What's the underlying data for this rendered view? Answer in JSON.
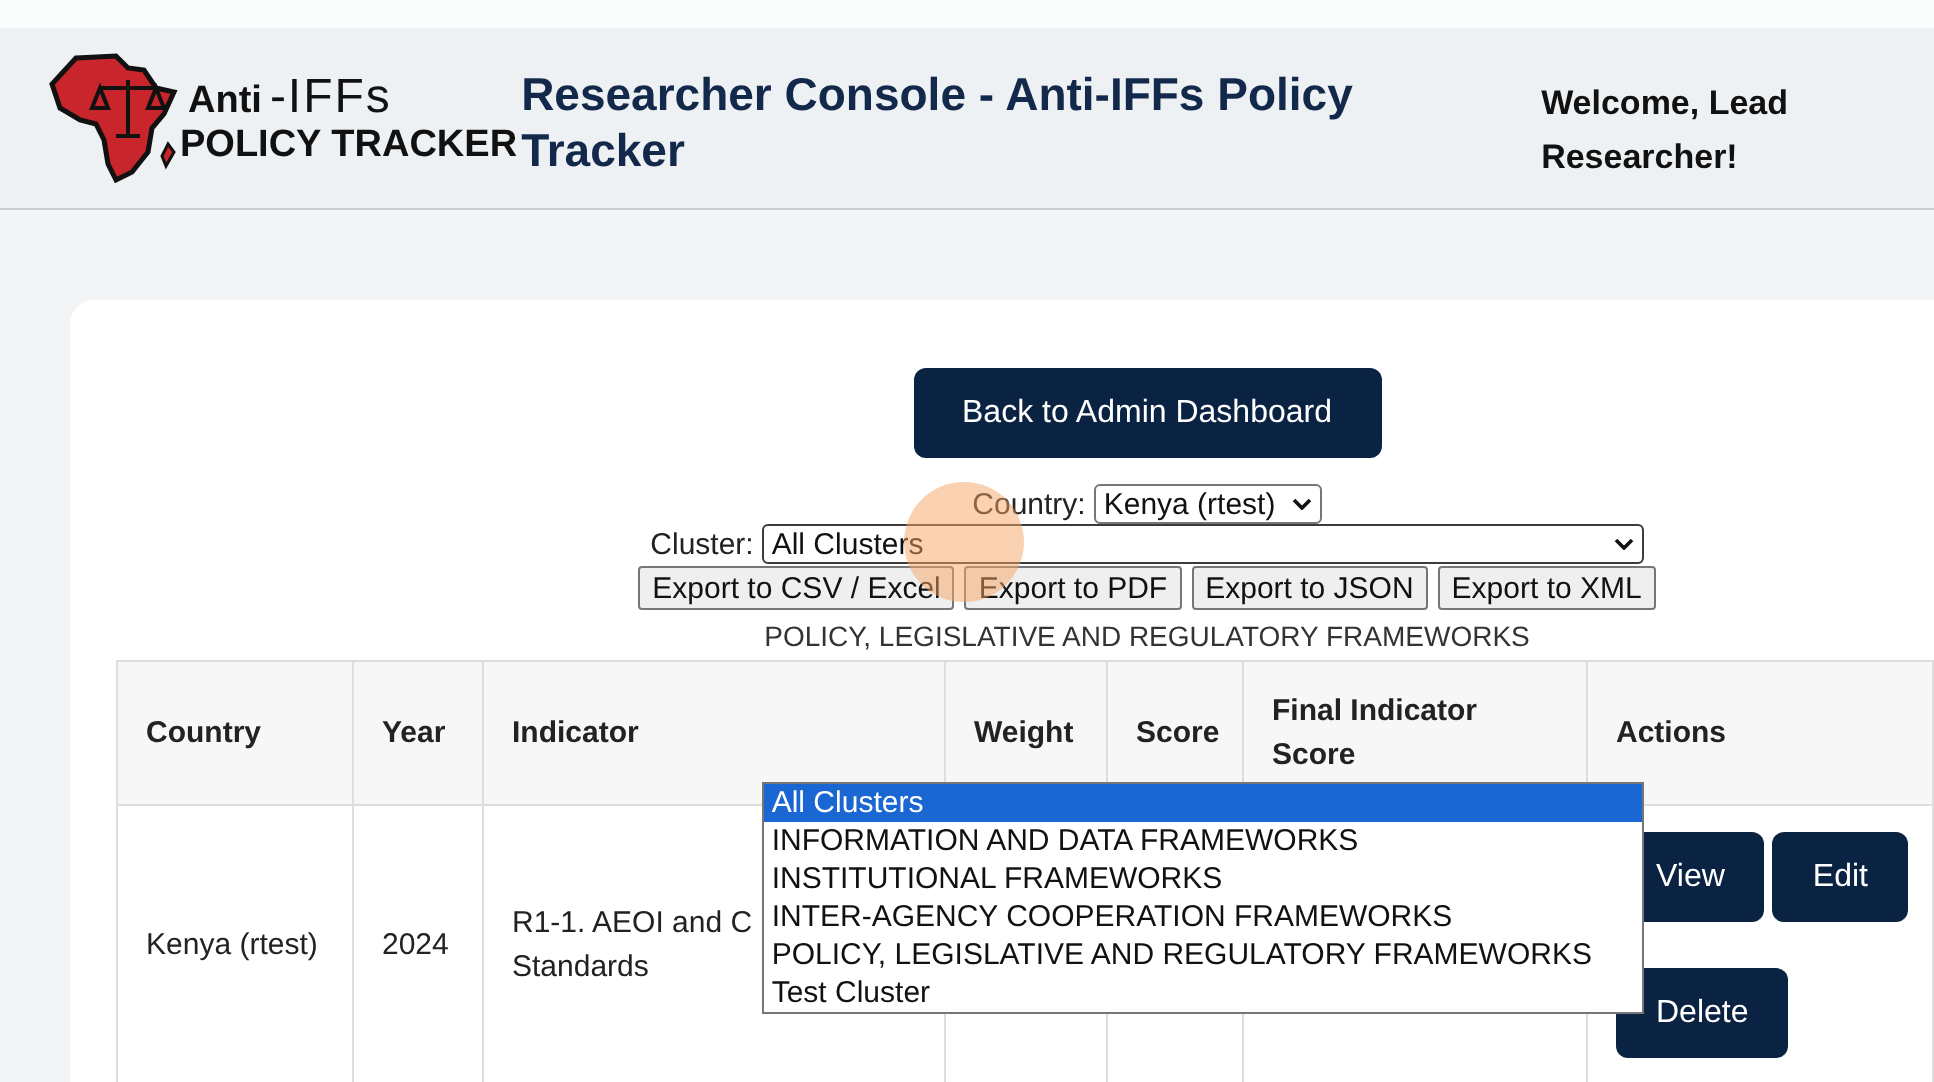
{
  "header": {
    "logo": {
      "word_1": "Anti",
      "word_2": "-IFFs",
      "line_2": "POLICY TRACKER"
    },
    "title": "Researcher Console - Anti-IFFs Policy Tracker",
    "welcome": "Welcome, Lead Researcher!"
  },
  "back_button": "Back to Admin Dashboard",
  "filters": {
    "country": {
      "label": "Country:",
      "value": "Kenya (rtest)"
    },
    "cluster": {
      "label": "Cluster:",
      "value": "All Clusters",
      "expanded": true,
      "options": [
        {
          "label": "All Clusters",
          "selected": true
        },
        {
          "label": "INFORMATION AND DATA FRAMEWORKS",
          "selected": false
        },
        {
          "label": "INSTITUTIONAL FRAMEWORKS",
          "selected": false
        },
        {
          "label": "INTER-AGENCY COOPERATION FRAMEWORKS",
          "selected": false
        },
        {
          "label": "POLICY, LEGISLATIVE AND REGULATORY FRAMEWORKS",
          "selected": false
        },
        {
          "label": "Test Cluster",
          "selected": false
        }
      ]
    }
  },
  "export_buttons": [
    "Export to CSV / Excel",
    "Export to PDF",
    "Export to JSON",
    "Export to XML"
  ],
  "section_heading": "POLICY, LEGISLATIVE AND REGULATORY FRAMEWORKS",
  "table": {
    "columns": [
      "Country",
      "Year",
      "Indicator",
      "Weight",
      "Score",
      "Final Indicator Score",
      "Actions"
    ],
    "rows": [
      {
        "country": "Kenya (rtest)",
        "year": "2024",
        "indicator": "R1-1. AEOI and C\nStandards",
        "actions": [
          "View",
          "Edit",
          "Delete"
        ]
      }
    ]
  }
}
